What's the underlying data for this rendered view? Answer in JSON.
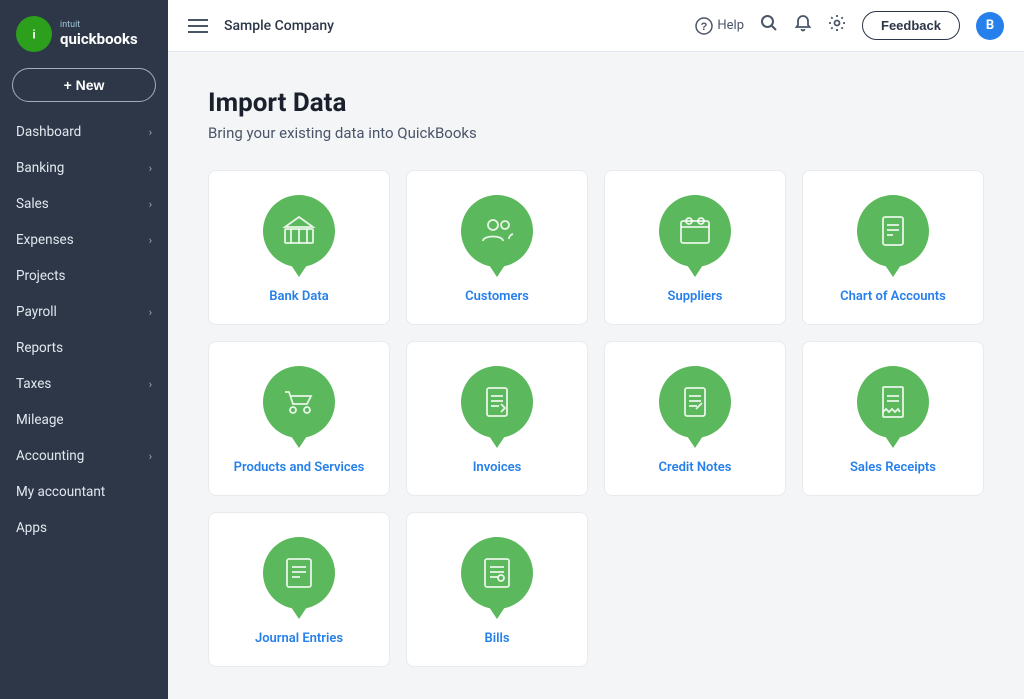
{
  "sidebar": {
    "logo_text": "quickbooks",
    "logo_initial": "i",
    "new_button": "+ New",
    "nav_items": [
      {
        "label": "Dashboard",
        "has_arrow": true
      },
      {
        "label": "Banking",
        "has_arrow": true
      },
      {
        "label": "Sales",
        "has_arrow": true
      },
      {
        "label": "Expenses",
        "has_arrow": true
      },
      {
        "label": "Projects",
        "has_arrow": false
      },
      {
        "label": "Payroll",
        "has_arrow": true
      },
      {
        "label": "Reports",
        "has_arrow": false
      },
      {
        "label": "Taxes",
        "has_arrow": true
      },
      {
        "label": "Mileage",
        "has_arrow": false
      },
      {
        "label": "Accounting",
        "has_arrow": true
      },
      {
        "label": "My accountant",
        "has_arrow": false
      },
      {
        "label": "Apps",
        "has_arrow": false
      }
    ]
  },
  "header": {
    "company": "Sample Company",
    "help": "Help",
    "feedback": "Feedback",
    "avatar_initial": "B"
  },
  "page": {
    "title": "Import Data",
    "subtitle": "Bring your existing data into QuickBooks"
  },
  "import_cards": [
    {
      "label": "Bank Data",
      "icon": "bank"
    },
    {
      "label": "Customers",
      "icon": "customers"
    },
    {
      "label": "Suppliers",
      "icon": "suppliers"
    },
    {
      "label": "Chart of Accounts",
      "icon": "accounts"
    },
    {
      "label": "Products and Services",
      "icon": "products"
    },
    {
      "label": "Invoices",
      "icon": "invoices"
    },
    {
      "label": "Credit Notes",
      "icon": "creditnotes"
    },
    {
      "label": "Sales Receipts",
      "icon": "receipts"
    },
    {
      "label": "Journal Entries",
      "icon": "journal"
    },
    {
      "label": "Bills",
      "icon": "bills"
    }
  ]
}
